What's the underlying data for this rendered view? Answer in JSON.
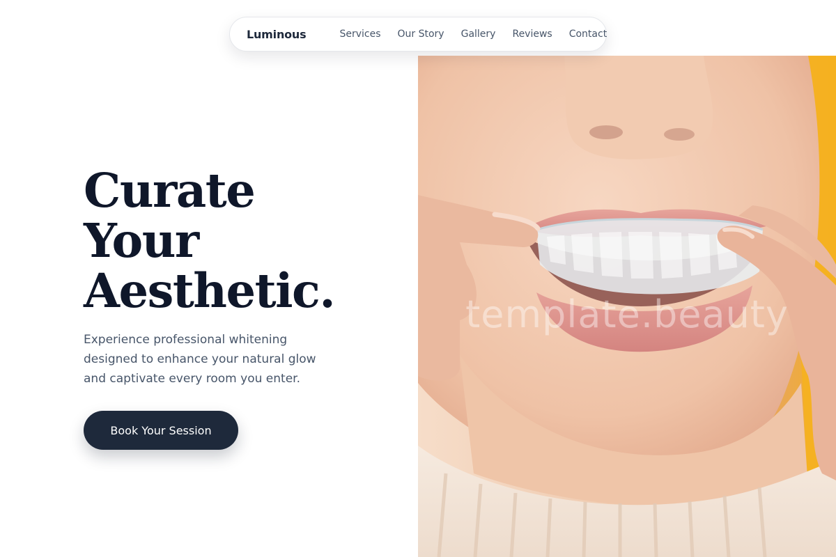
{
  "nav": {
    "brand": "Luminous",
    "links": [
      "Services",
      "Our Story",
      "Gallery",
      "Reviews",
      "Contact"
    ]
  },
  "hero": {
    "title_lines": [
      "Curate",
      "Your",
      "Aesthetic."
    ],
    "subtitle": "Experience professional whitening designed to enhance your natural glow and captivate every room you enter.",
    "cta_label": "Book Your Session",
    "image_watermark": "template.beauty"
  },
  "colors": {
    "ink": "#0f172a",
    "cta_background": "#1e293b",
    "muted_text": "#475569",
    "image_accent": "#f5b120"
  }
}
